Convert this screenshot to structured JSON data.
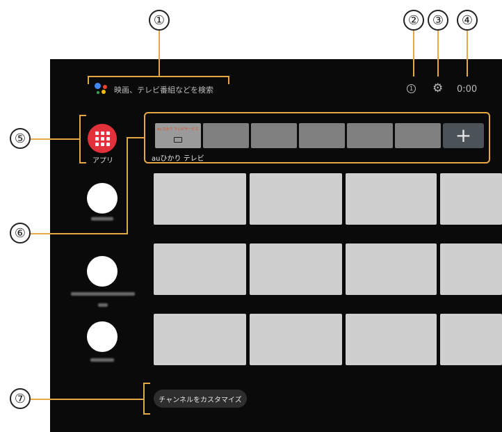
{
  "search": {
    "placeholder": "映画、テレビ番組などを検索"
  },
  "status": {
    "notification_count": "1",
    "clock": "0:00"
  },
  "sidebar": {
    "apps_label": "アプリ"
  },
  "channel": {
    "label": "auひかり テレビ",
    "brand_text": "au ひかり テレビサービス"
  },
  "footer": {
    "customize_label": "チャンネルをカスタマイズ"
  },
  "callouts": [
    "①",
    "②",
    "③",
    "④",
    "⑤",
    "⑥",
    "⑦"
  ],
  "colors": {
    "accent": "#e6a847",
    "apps_red": "#e2313b",
    "screen_bg": "#0a0a0a"
  }
}
